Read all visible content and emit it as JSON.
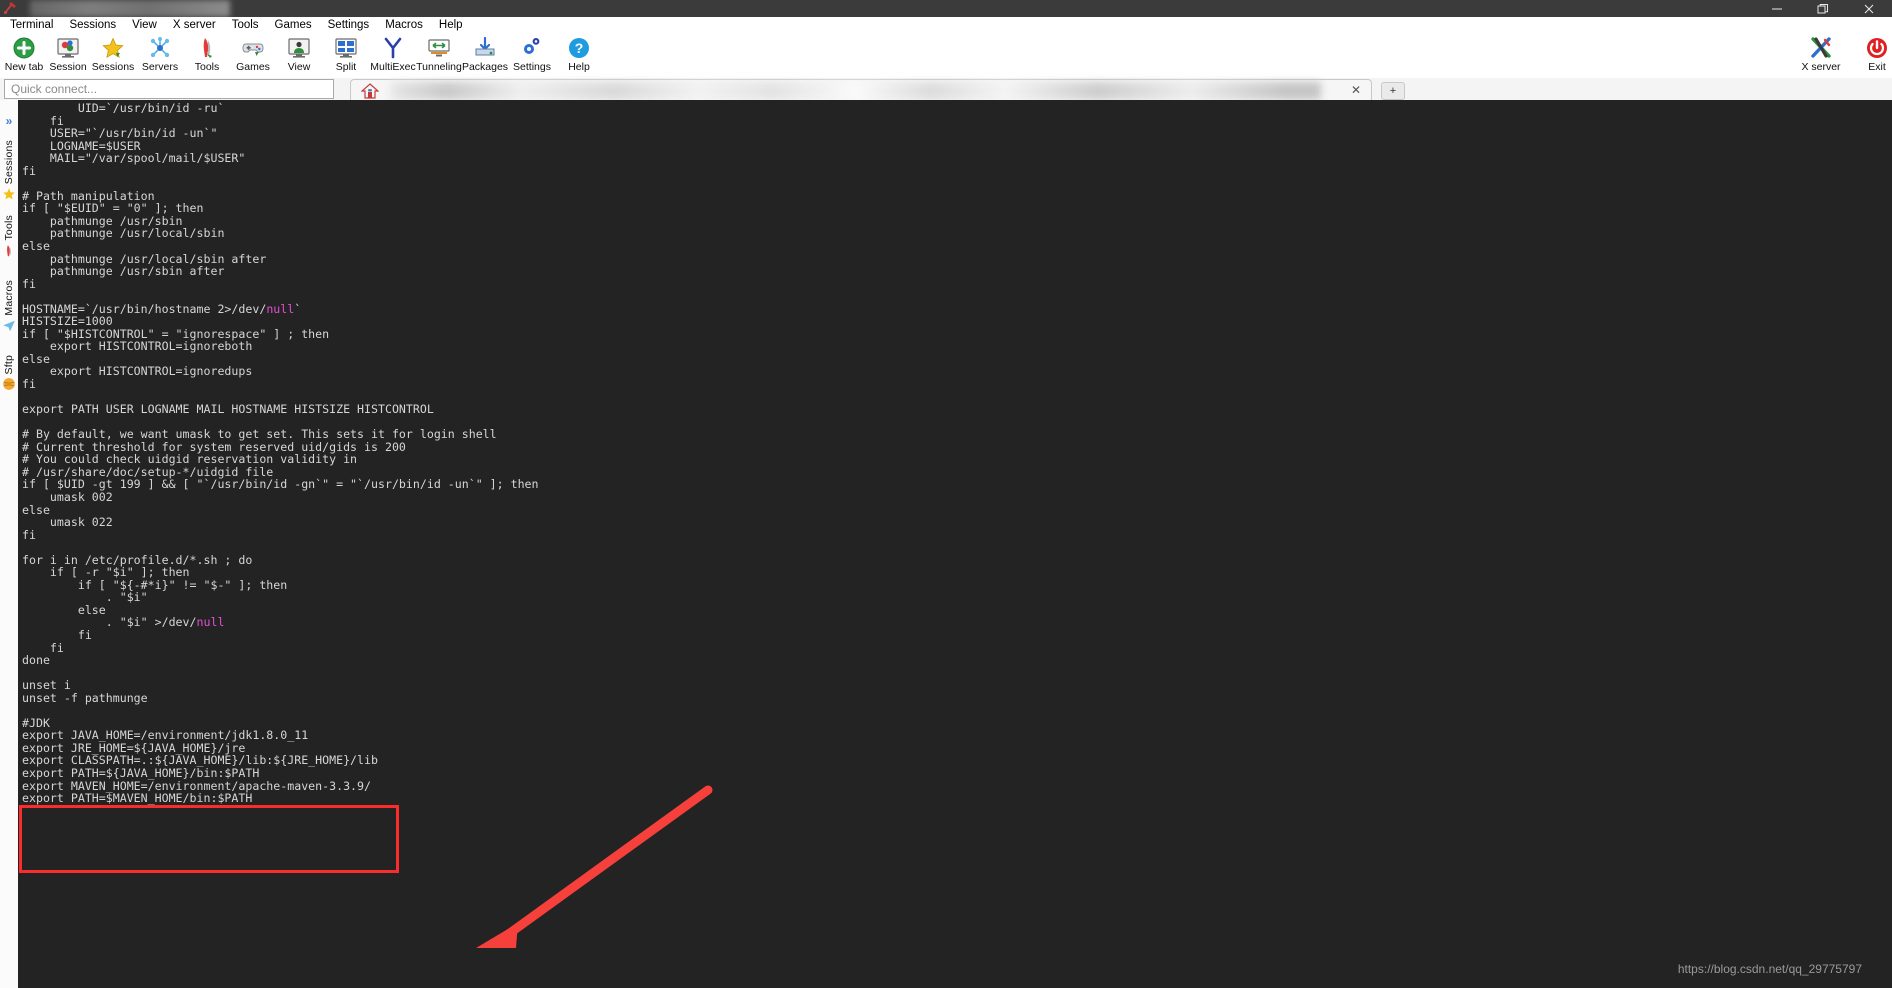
{
  "window": {
    "title_blurred": true,
    "buttons": [
      {
        "name": "minimize",
        "glyph": "—"
      },
      {
        "name": "restore",
        "glyph": "❐"
      },
      {
        "name": "close",
        "glyph": "✕"
      }
    ]
  },
  "menubar": {
    "items": [
      "Terminal",
      "Sessions",
      "View",
      "X server",
      "Tools",
      "Games",
      "Settings",
      "Macros",
      "Help"
    ]
  },
  "toolbar": {
    "items": [
      {
        "label": "New tab",
        "icon": "plus-circle-icon"
      },
      {
        "label": "Session",
        "icon": "session-monitor-icon"
      },
      {
        "label": "Sessions",
        "icon": "star-icon"
      },
      {
        "label": "Servers",
        "icon": "network-nodes-icon"
      },
      {
        "label": "Tools",
        "icon": "swiss-knife-icon"
      },
      {
        "label": "Games",
        "icon": "gamepad-icon"
      },
      {
        "label": "View",
        "icon": "monitor-user-icon"
      },
      {
        "label": "Split",
        "icon": "split-grid-icon"
      },
      {
        "label": "MultiExec",
        "icon": "fork-y-icon"
      },
      {
        "label": "Tunneling",
        "icon": "tunnel-arrows-icon"
      },
      {
        "label": "Packages",
        "icon": "download-box-icon"
      },
      {
        "label": "Settings",
        "icon": "gears-icon"
      },
      {
        "label": "Help",
        "icon": "question-circle-icon"
      }
    ],
    "right_items": [
      {
        "label": "X server",
        "icon": "x-server-icon"
      },
      {
        "label": "Exit",
        "icon": "power-exit-icon"
      }
    ]
  },
  "quick_connect": {
    "placeholder": "Quick connect...",
    "value": ""
  },
  "tabs": {
    "active": {
      "title_blurred": true,
      "icon": "home-icon",
      "close_glyph": "✕"
    },
    "new_tab_glyph": "+"
  },
  "sidebar": {
    "expand_glyph": "»",
    "items": [
      {
        "label": "Sessions",
        "icon": "star-icon"
      },
      {
        "label": "Tools",
        "icon": "swiss-knife-icon"
      },
      {
        "label": "Macros",
        "icon": "paper-plane-icon"
      },
      {
        "label": "Sftp",
        "icon": "globe-icon"
      }
    ]
  },
  "terminal": {
    "lines_part1": "        UID=`/usr/bin/id -ru`\n    fi\n    USER=\"`/usr/bin/id -un`\"\n    LOGNAME=$USER\n    MAIL=\"/var/spool/mail/$USER\"\nfi\n\n# Path manipulation\nif [ \"$EUID\" = \"0\" ]; then\n    pathmunge /usr/sbin\n    pathmunge /usr/local/sbin\nelse\n    pathmunge /usr/local/sbin after\n    pathmunge /usr/sbin after\nfi\n\nHOSTNAME=`/usr/bin/hostname 2>/dev/",
    "hl1": "null",
    "lines_part2": "`\nHISTSIZE=1000\nif [ \"$HISTCONTROL\" = \"ignorespace\" ] ; then\n    export HISTCONTROL=ignoreboth\nelse\n    export HISTCONTROL=ignoredups\nfi\n\nexport PATH USER LOGNAME MAIL HOSTNAME HISTSIZE HISTCONTROL\n\n# By default, we want umask to get set. This sets it for login shell\n# Current threshold for system reserved uid/gids is 200\n# You could check uidgid reservation validity in\n# /usr/share/doc/setup-*/uidgid file\nif [ $UID -gt 199 ] && [ \"`/usr/bin/id -gn`\" = \"`/usr/bin/id -un`\" ]; then\n    umask 002\nelse\n    umask 022\nfi\n\nfor i in /etc/profile.d/*.sh ; do\n    if [ -r \"$i\" ]; then\n        if [ \"${-#*i}\" != \"$-\" ]; then\n            . \"$i\"\n        else\n            . \"$i\" >/dev/",
    "hl2": "null",
    "lines_part3": "\n        fi\n    fi\ndone\n\nunset i\nunset -f pathmunge\n\n#JDK\nexport JAVA_HOME=/environment/jdk1.8.0_11\nexport JRE_HOME=${JAVA_HOME}/jre\nexport CLASSPATH=.:${JAVA_HOME}/lib:${JRE_HOME}/lib\nexport PATH=${JAVA_HOME}/bin:$PATH\nexport MAVEN_HOME=/environment/apache-maven-3.3.9/\nexport PATH=$MAVEN_HOME/bin:$PATH",
    "watermark": "https://blog.csdn.net/qq_29775797"
  },
  "annotations": {
    "highlight_box": {
      "color": "#fb2c2c",
      "note": "red rectangle around JDK export block"
    },
    "arrow": {
      "color": "#f6403c",
      "note": "red arrow pointing to JDK block"
    }
  },
  "colors": {
    "terminal_bg": "#232323",
    "terminal_fg": "#d6d6d6",
    "magenta": "#e050d0",
    "accent_red": "#fb2c2c",
    "titlebar_bg": "#3b3b3b"
  }
}
